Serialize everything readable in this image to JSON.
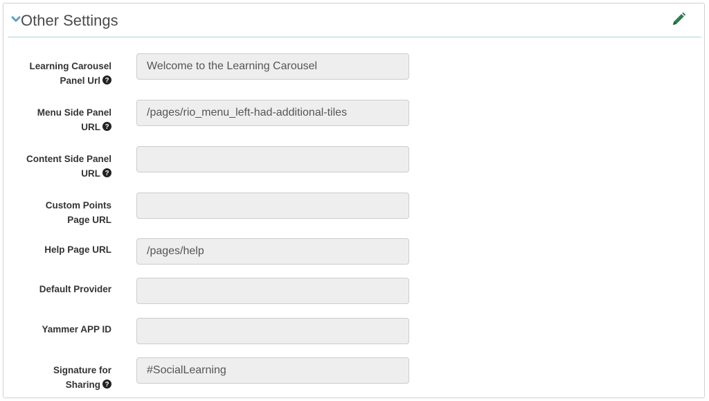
{
  "header": {
    "title": "Other Settings",
    "collapse_icon": "chevron-down-icon",
    "edit_icon": "pencil-icon"
  },
  "colors": {
    "accent": "#5aa0c8",
    "edit_icon": "#2e7d4f",
    "header_rule": "#a9d3df",
    "field_bg": "#eeeeee"
  },
  "fields": [
    {
      "label_line1": "Learning Carousel",
      "label_line2": "Panel Url",
      "help": true,
      "value": "Welcome to the Learning Carousel"
    },
    {
      "label_line1": "Menu Side Panel",
      "label_line2": "URL",
      "help": true,
      "value": "/pages/rio_menu_left-had-additional-tiles"
    },
    {
      "label_line1": "Content Side Panel",
      "label_line2": "URL",
      "help": true,
      "value": ""
    },
    {
      "label_line1": "Custom Points",
      "label_line2": "Page URL",
      "help": false,
      "value": ""
    },
    {
      "label_line1": "Help Page URL",
      "label_line2": "",
      "help": false,
      "value": "/pages/help"
    },
    {
      "label_line1": "Default Provider",
      "label_line2": "",
      "help": false,
      "value": ""
    },
    {
      "label_line1": "Yammer APP ID",
      "label_line2": "",
      "help": false,
      "value": ""
    },
    {
      "label_line1": "Signature for",
      "label_line2": "Sharing",
      "help": true,
      "value": "#SocialLearning"
    }
  ]
}
